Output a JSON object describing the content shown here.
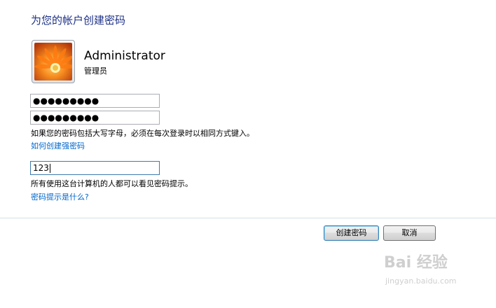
{
  "dialog": {
    "title": "为您的帐户创建密码"
  },
  "account": {
    "name": "Administrator",
    "role": "管理员",
    "avatar_icon": "orange-flower-picture"
  },
  "fields": {
    "new_password": "●●●●●●●●●",
    "confirm_password": "●●●●●●●●●",
    "password_hint": "123"
  },
  "messages": {
    "caps_warning": "如果您的密码包括大写字母，必须在每次登录时以相同方式键入。",
    "strong_password_link": "如何创建强密码",
    "hint_visibility": "所有使用这台计算机的人都可以看见密码提示。",
    "hint_link": "密码提示是什么?"
  },
  "buttons": {
    "create": "创建密码",
    "cancel": "取消"
  },
  "watermark": {
    "logo": "Bai 经验",
    "url": "jingyan.baidu.com"
  }
}
